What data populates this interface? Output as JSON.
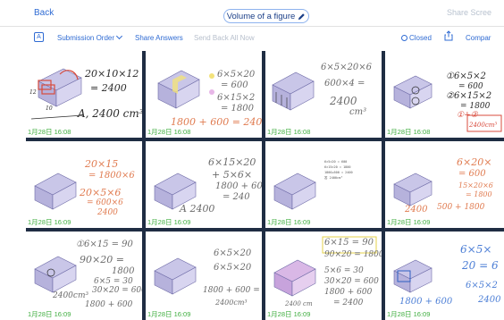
{
  "header": {
    "back_label": "Back",
    "title": "Volume of a figure",
    "share_screen_label": "Share Scree"
  },
  "toolbar": {
    "a_label": "A",
    "submission_order_label": "Submission Order",
    "share_answers_label": "Share Answers",
    "send_back_all_label": "Send Back All Now",
    "closed_label": "Closed",
    "compare_label": "Compar"
  },
  "tiles": [
    {
      "date": "1月28日 16:08",
      "lines": [
        "20×10×12",
        "= 2400",
        "A, 2400 cm³",
        "12",
        "10"
      ]
    },
    {
      "date": "1月28日 16:08",
      "lines": [
        "6×5×20",
        "= 600",
        "6×15×2",
        "= 1800",
        "1800 + 600 = 2400"
      ]
    },
    {
      "date": "1月28日 16:08",
      "lines": [
        "6×5×20×6",
        "600×4 =",
        "2400",
        "cm³"
      ]
    },
    {
      "date": "1月28日 16:08",
      "lines": [
        "①6×5×2",
        "= 600",
        "②6×15×2",
        "= 1800",
        "①+②",
        "2400cm³"
      ]
    },
    {
      "date": "1月28日 16:09",
      "lines": [
        "20×15",
        "= 1800×6",
        "20×5×6",
        "= 600×6",
        "2400"
      ]
    },
    {
      "date": "1月28日 16:09",
      "lines": [
        "6×15×20",
        "+ 5×6×",
        "1800 + 60",
        "= 240",
        "A 2400"
      ]
    },
    {
      "date": "1月28日 16:09",
      "lines": [
        "6×5×20 = 600",
        "6×15×20 = 1800",
        "1800+600 = 2400",
        "答 2400cm³"
      ]
    },
    {
      "date": "1月28日 16:09",
      "lines": [
        "6×20×",
        "= 600",
        "15×20×6",
        "= 1800",
        "2400",
        "500 + 1800"
      ]
    },
    {
      "date": "1月28日 16:09",
      "lines": [
        "①6×15 = 90",
        "90×20 =",
        "1800",
        "6×5 = 30",
        "30×20 = 600",
        "2400cm³",
        "1800 + 600"
      ]
    },
    {
      "date": "1月28日 16:09",
      "lines": [
        "6×5×20",
        "6×5×20",
        "1800 + 600 = 24",
        "2400cm³"
      ]
    },
    {
      "date": "1月28日 16:09",
      "lines": [
        "6×15 = 90",
        "90×20 = 1800",
        "5×6 = 30",
        "30×20 = 600",
        "1800 + 600",
        "= 2400",
        "2400 cm"
      ]
    },
    {
      "date": "1月28日 16:09",
      "lines": [
        "6×5×",
        "20 = 6",
        "6×5×2",
        "1800 + 600",
        "2400"
      ]
    }
  ]
}
